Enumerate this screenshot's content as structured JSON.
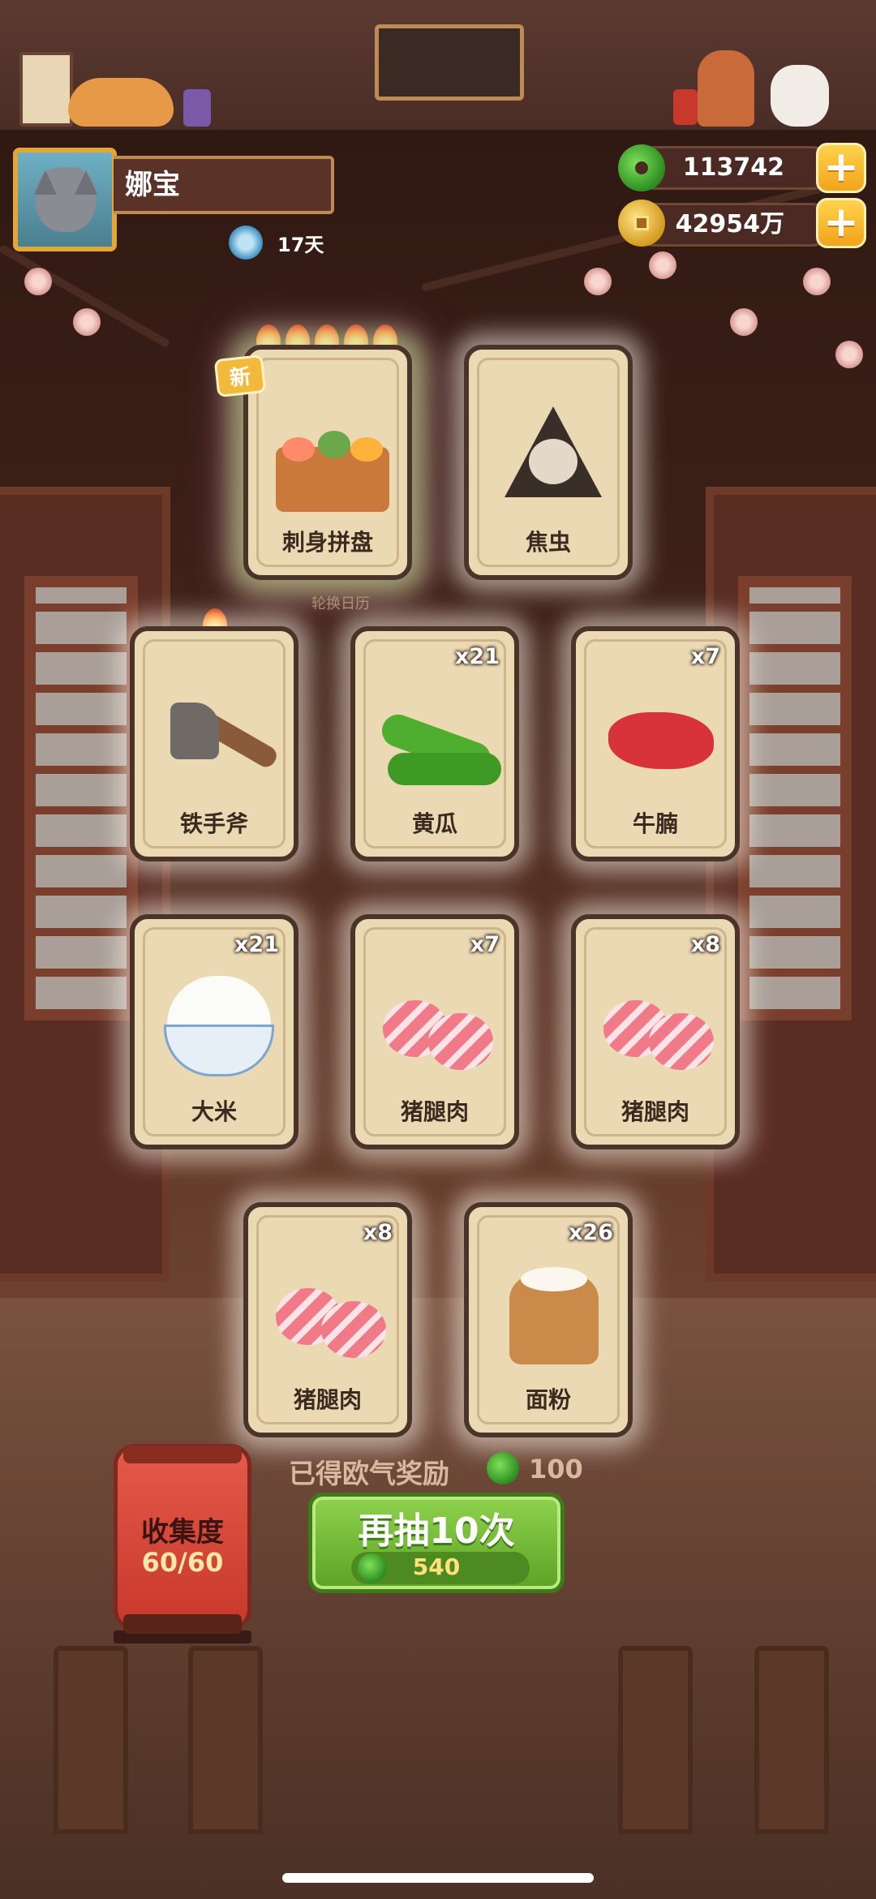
{
  "player": {
    "name": "娜宝",
    "days": "17天"
  },
  "currency": {
    "jade": "113742",
    "gold": "42954万",
    "add_symbol": "+"
  },
  "new_badge": "新",
  "rotate_label": "轮换日历",
  "cards": [
    {
      "label": "刺身拼盘",
      "count": "",
      "rarity": "special",
      "flames": 5,
      "is_new": true
    },
    {
      "label": "焦虫",
      "count": "",
      "rarity": "locked"
    },
    {
      "label": "铁手斧",
      "count": "",
      "flames": 1
    },
    {
      "label": "黄瓜",
      "count": "x21"
    },
    {
      "label": "牛腩",
      "count": "x7"
    },
    {
      "label": "大米",
      "count": "x21"
    },
    {
      "label": "猪腿肉",
      "count": "x7"
    },
    {
      "label": "猪腿肉",
      "count": "x8"
    },
    {
      "label": "猪腿肉",
      "count": "x8"
    },
    {
      "label": "面粉",
      "count": "x26"
    }
  ],
  "reward": {
    "text": "已得欧气奖励",
    "value": "100"
  },
  "draw_button": {
    "label": "再抽10次",
    "cost": "540"
  },
  "collection": {
    "title": "收集度",
    "progress": "60/60"
  },
  "colors": {
    "accent_green": "#5da226",
    "gold": "#f2a31b",
    "card_bg": "#ebd9b3"
  }
}
